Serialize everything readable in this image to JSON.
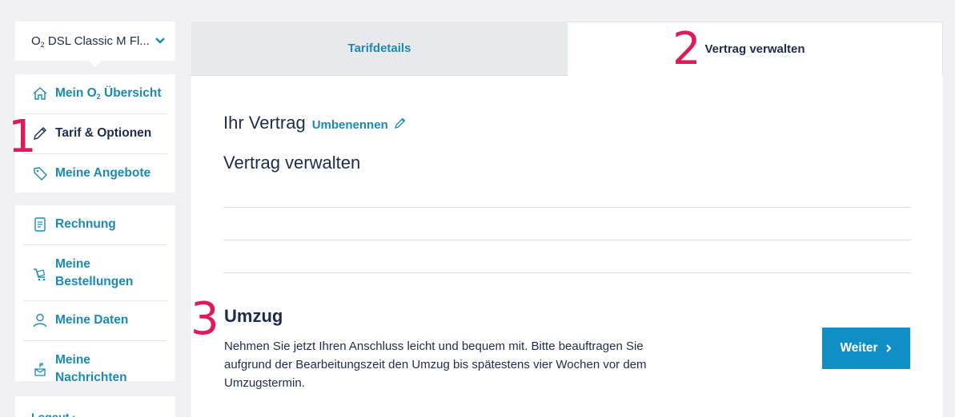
{
  "contract": {
    "label_prefix": "O",
    "label_sub": "2",
    "label_rest": " DSL Classic M Fl...",
    "chevron_icon": "chevron-down-icon"
  },
  "nav_primary": [
    {
      "id": "overview",
      "label_prefix": "Mein O",
      "label_sub": "2",
      "label_rest": " Übersicht",
      "icon": "home-icon"
    },
    {
      "id": "tarif",
      "label": "Tarif & Optionen",
      "icon": "pencil-icon",
      "active": true
    },
    {
      "id": "offers",
      "label": "Meine Angebote",
      "icon": "tag-icon"
    }
  ],
  "nav_secondary": [
    {
      "id": "invoice",
      "label": "Rechnung",
      "icon": "document-icon"
    },
    {
      "id": "orders",
      "label_line1": "Meine",
      "label_line2": "Bestellungen",
      "icon": "cart-icon"
    },
    {
      "id": "data",
      "label": "Meine Daten",
      "icon": "user-icon"
    },
    {
      "id": "messages",
      "label_line1": "Meine",
      "label_line2": "Nachrichten",
      "icon": "mailbox-icon"
    }
  ],
  "logout": {
    "label": "Logout"
  },
  "tabs": [
    {
      "label": "Tarifdetails",
      "active": false
    },
    {
      "label": "Vertrag verwalten",
      "active": true
    }
  ],
  "main": {
    "contract_title": "Ihr Vertrag",
    "rename_link": "Umbenennen",
    "section_title": "Vertrag verwalten",
    "umzug": {
      "title": "Umzug",
      "text": "Nehmen Sie jetzt Ihren Anschluss leicht und bequem mit. Bitte beauftragen Sie aufgrund der Bearbeitungszeit den Umzug bis spätestens vier Wochen vor dem Umzugstermin.",
      "button": "Weiter"
    }
  },
  "annotations": {
    "one": "1",
    "two": "2",
    "three": "3"
  },
  "colors": {
    "accent": "#1a8ab5",
    "button": "#0f8fc6",
    "text": "#1e2b4c",
    "annotation": "#e0195a",
    "background": "#f1f1f3"
  }
}
